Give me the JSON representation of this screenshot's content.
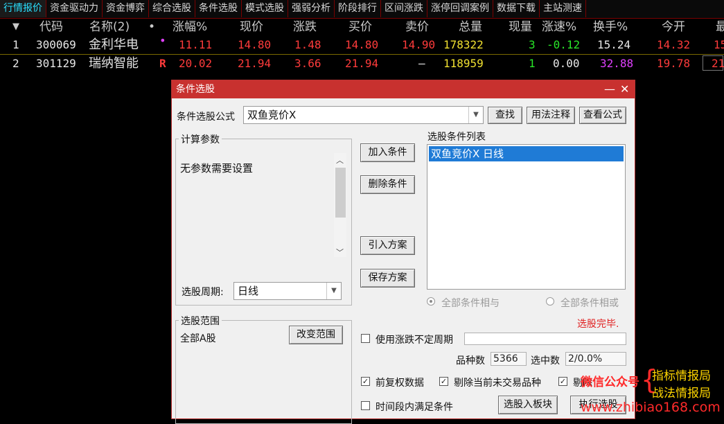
{
  "tabs": [
    "行情报价",
    "资金驱动力",
    "资金博弈",
    "综合选股",
    "条件选股",
    "模式选股",
    "强弱分析",
    "阶段排行",
    "区间涨跌",
    "涨停回调案例",
    "数据下载",
    "主站测速"
  ],
  "table": {
    "headers": {
      "arrow": "▼",
      "code": "代码",
      "name": "名称(2)",
      "dot": "•",
      "change_pct": "涨幅%",
      "price": "现价",
      "change": "涨跌",
      "bid": "买价",
      "ask": "卖价",
      "volume": "总量",
      "cur_vol": "现量",
      "speed": "涨速%",
      "turnover": "换手%",
      "open": "今开",
      "more": "最"
    },
    "rows": [
      {
        "idx": "1",
        "code": "300069",
        "name": "金利华电",
        "flag": "•",
        "change_pct": "11.11",
        "price": "14.80",
        "change": "1.48",
        "bid": "14.80",
        "ask": "14.90",
        "volume": "178322",
        "cur_vol": "3",
        "speed": "-0.12",
        "turnover": "15.24",
        "open": "14.32",
        "more": "15"
      },
      {
        "idx": "2",
        "code": "301129",
        "name": "瑞纳智能",
        "flag": "R",
        "change_pct": "20.02",
        "price": "21.94",
        "change": "3.66",
        "bid": "21.94",
        "ask": "—",
        "volume": "118959",
        "cur_vol": "1",
        "speed": "0.00",
        "turnover": "32.88",
        "open": "19.78",
        "more": "21"
      }
    ]
  },
  "dialog": {
    "title": "条件选股",
    "minimize": "—",
    "close": "✕",
    "formula_label": "条件选股公式",
    "formula_value": "双鱼竞价X",
    "btn_find": "查找",
    "btn_usage": "用法注释",
    "btn_view": "查看公式",
    "params_legend": "计算参数",
    "params_text": "无参数需要设置",
    "period_label": "选股周期:",
    "period_value": "日线",
    "btn_add": "加入条件",
    "btn_delete": "删除条件",
    "btn_import": "引入方案",
    "btn_save": "保存方案",
    "list_label": "选股条件列表",
    "list_items": [
      "双鱼竞价X  日线"
    ],
    "radio_and": "全部条件相与",
    "radio_or": "全部条件相或",
    "status": "选股完毕.",
    "range_legend": "选股范围",
    "range_value": "全部A股",
    "btn_change_range": "改变范围",
    "use_period_label": "使用涨跌不定周期",
    "count_label": "品种数",
    "count_value": "5366",
    "selected_label": "选中数",
    "selected_value": "2/0.0%",
    "chk_fq": "前复权数据",
    "chk_exclude": "剔除当前未交易品种",
    "chk_third": "剔除",
    "chk_time": "时间段内满足条件",
    "btn_to_board": "选股入板块",
    "btn_execute": "执行选股"
  },
  "watermark": {
    "wechat": "微信公众号",
    "line1": "指标情报局",
    "line2": "战法情报局",
    "url": "www.zhibiao168.com"
  }
}
